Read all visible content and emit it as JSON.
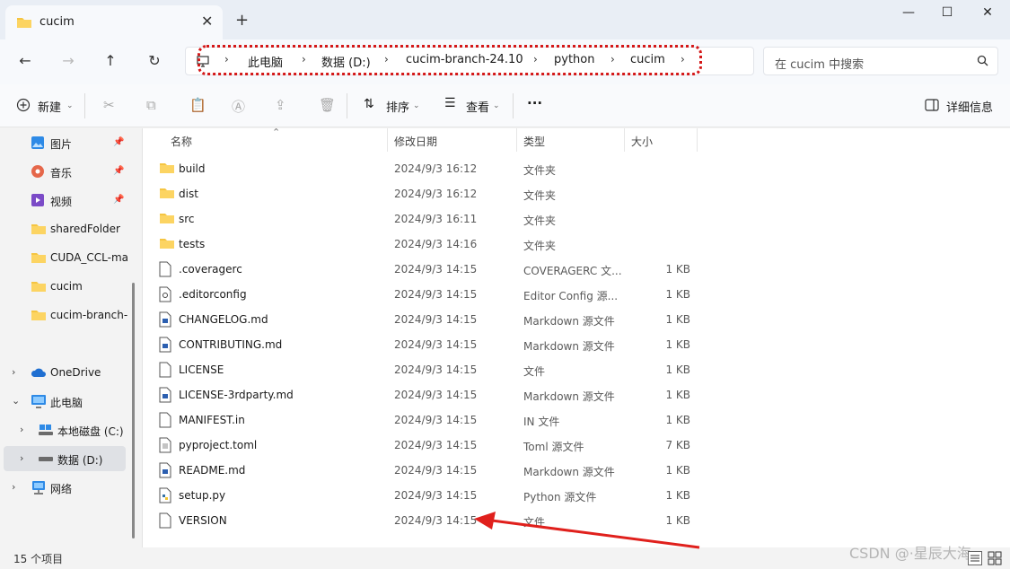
{
  "window": {
    "tab_title": "cucim",
    "new_tab_symbol": "+",
    "close_tab_symbol": "✕",
    "minimize_symbol": "—",
    "maximize_symbol": "☐",
    "close_symbol": "✕"
  },
  "nav": {
    "back_symbol": "←",
    "forward_symbol": "→",
    "up_symbol": "↑",
    "refresh_symbol": "↻"
  },
  "breadcrumb": {
    "items": [
      "此电脑",
      "数据 (D:)",
      "cucim-branch-24.10",
      "python",
      "cucim"
    ],
    "separator": "›"
  },
  "search": {
    "placeholder": "在 cucim 中搜索",
    "icon": "search-icon"
  },
  "toolbar": {
    "new_label": "新建",
    "sort_label": "排序",
    "view_label": "查看",
    "more_label": "···",
    "details_label": "详细信息"
  },
  "sidebar": {
    "quick_access": [
      {
        "label": "图片",
        "icon": "pictures-icon",
        "pinned": true
      },
      {
        "label": "音乐",
        "icon": "music-icon",
        "pinned": true
      },
      {
        "label": "视频",
        "icon": "videos-icon",
        "pinned": true
      },
      {
        "label": "sharedFolder",
        "icon": "folder-icon",
        "pinned": false
      },
      {
        "label": "CUDA_CCL-ma",
        "icon": "folder-icon",
        "pinned": false
      },
      {
        "label": "cucim",
        "icon": "folder-icon",
        "pinned": false
      },
      {
        "label": "cucim-branch-",
        "icon": "folder-icon",
        "pinned": false
      }
    ],
    "tree": [
      {
        "label": "OneDrive",
        "icon": "cloud-icon",
        "chevron": "›"
      },
      {
        "label": "此电脑",
        "icon": "pc-icon",
        "chevron": "⌄"
      },
      {
        "label": "本地磁盘 (C:)",
        "icon": "drive-icon",
        "chevron": "›"
      },
      {
        "label": "数据 (D:)",
        "icon": "drive-icon",
        "chevron": "›"
      },
      {
        "label": "网络",
        "icon": "network-icon",
        "chevron": "›"
      }
    ]
  },
  "columns": {
    "name": "名称",
    "date": "修改日期",
    "type": "类型",
    "size": "大小"
  },
  "files": [
    {
      "name": "build",
      "date": "2024/9/3 16:12",
      "type": "文件夹",
      "size": "",
      "kind": "folder"
    },
    {
      "name": "dist",
      "date": "2024/9/3 16:12",
      "type": "文件夹",
      "size": "",
      "kind": "folder"
    },
    {
      "name": "src",
      "date": "2024/9/3 16:11",
      "type": "文件夹",
      "size": "",
      "kind": "folder"
    },
    {
      "name": "tests",
      "date": "2024/9/3 14:16",
      "type": "文件夹",
      "size": "",
      "kind": "folder"
    },
    {
      "name": ".coveragerc",
      "date": "2024/9/3 14:15",
      "type": "COVERAGERC 文...",
      "size": "1 KB",
      "kind": "file"
    },
    {
      "name": ".editorconfig",
      "date": "2024/9/3 14:15",
      "type": "Editor Config 源...",
      "size": "1 KB",
      "kind": "config"
    },
    {
      "name": "CHANGELOG.md",
      "date": "2024/9/3 14:15",
      "type": "Markdown 源文件",
      "size": "1 KB",
      "kind": "md"
    },
    {
      "name": "CONTRIBUTING.md",
      "date": "2024/9/3 14:15",
      "type": "Markdown 源文件",
      "size": "1 KB",
      "kind": "md"
    },
    {
      "name": "LICENSE",
      "date": "2024/9/3 14:15",
      "type": "文件",
      "size": "1 KB",
      "kind": "file"
    },
    {
      "name": "LICENSE-3rdparty.md",
      "date": "2024/9/3 14:15",
      "type": "Markdown 源文件",
      "size": "1 KB",
      "kind": "md"
    },
    {
      "name": "MANIFEST.in",
      "date": "2024/9/3 14:15",
      "type": "IN 文件",
      "size": "1 KB",
      "kind": "file"
    },
    {
      "name": "pyproject.toml",
      "date": "2024/9/3 14:15",
      "type": "Toml 源文件",
      "size": "7 KB",
      "kind": "text"
    },
    {
      "name": "README.md",
      "date": "2024/9/3 14:15",
      "type": "Markdown 源文件",
      "size": "1 KB",
      "kind": "md"
    },
    {
      "name": "setup.py",
      "date": "2024/9/3 14:15",
      "type": "Python 源文件",
      "size": "1 KB",
      "kind": "py"
    },
    {
      "name": "VERSION",
      "date": "2024/9/3 14:15",
      "type": "文件",
      "size": "1 KB",
      "kind": "file"
    }
  ],
  "status": {
    "item_count": "15 个项目"
  },
  "watermark": "CSDN @·星辰大海",
  "colors": {
    "folder": "#f5c542",
    "highlight_border": "#d41818",
    "arrow": "#e0201c"
  }
}
